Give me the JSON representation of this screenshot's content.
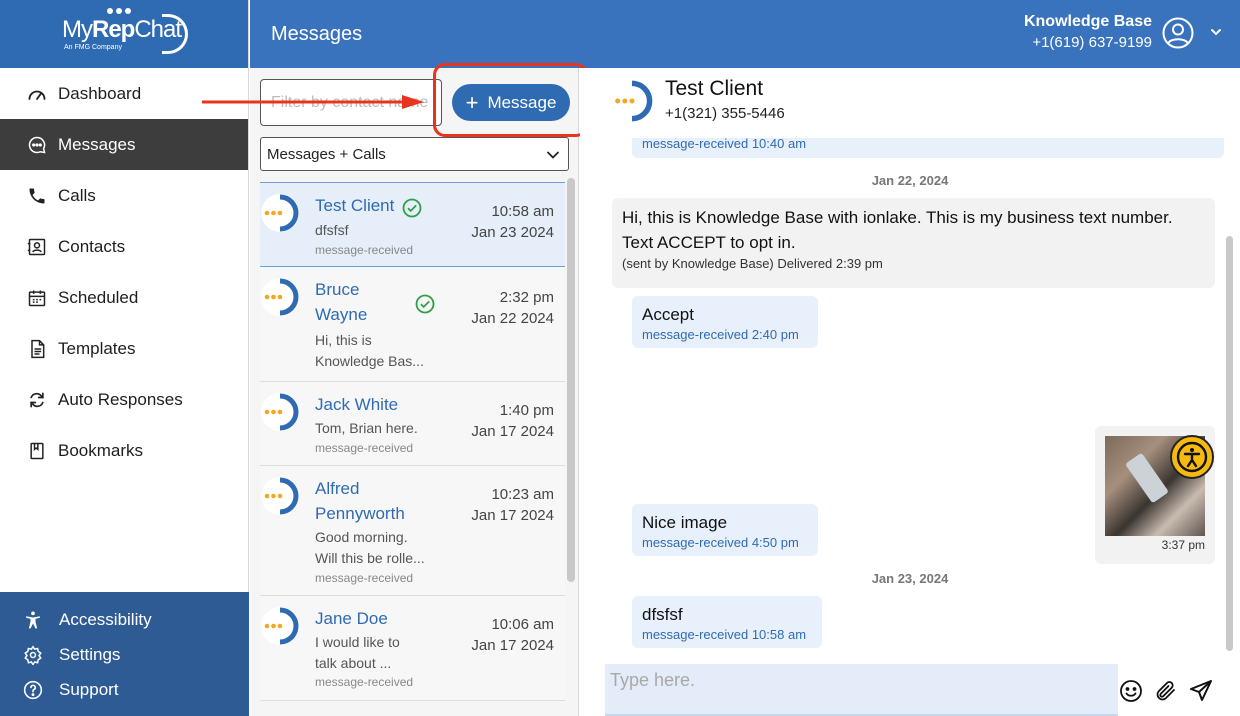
{
  "logo": {
    "text_my": "My",
    "text_rep": "Rep",
    "text_chat": "Chat",
    "tagline": "An FMG Company"
  },
  "sidebar": {
    "items": [
      {
        "label": "Dashboard",
        "icon": "gauge-icon"
      },
      {
        "label": "Messages",
        "icon": "chat-bubble-icon",
        "active": true
      },
      {
        "label": "Calls",
        "icon": "phone-icon"
      },
      {
        "label": "Contacts",
        "icon": "contact-card-icon"
      },
      {
        "label": "Scheduled",
        "icon": "calendar-icon"
      },
      {
        "label": "Templates",
        "icon": "document-icon"
      },
      {
        "label": "Auto Responses",
        "icon": "refresh-icon"
      },
      {
        "label": "Bookmarks",
        "icon": "bookmark-icon"
      }
    ],
    "footer": [
      {
        "label": "Accessibility",
        "icon": "accessibility-icon"
      },
      {
        "label": "Settings",
        "icon": "gear-icon"
      },
      {
        "label": "Support",
        "icon": "help-icon"
      }
    ]
  },
  "header": {
    "title": "Messages",
    "account_name": "Knowledge Base",
    "account_phone": "+1(619) 637-9199"
  },
  "list": {
    "filter_placeholder": "Filter by contact name",
    "new_message_label": "Message",
    "type_select": "Messages + Calls",
    "conversations": [
      {
        "name": "Test Client",
        "preview": "dfsfsf",
        "status": "message-received",
        "time": "10:58 am",
        "date": "Jan 23 2024",
        "checked": true
      },
      {
        "name": "Bruce Wayne",
        "name_line1": "Bruce",
        "name_line2": "Wayne",
        "preview": "Hi, this is Knowledge Bas...",
        "preview_line1": "Hi, this is",
        "preview_line2": "Knowledge Bas...",
        "time": "2:32 pm",
        "date": "Jan 22 2024",
        "checked": true
      },
      {
        "name": "Jack White",
        "preview": "Tom, Brian here.",
        "status": "message-received",
        "time": "1:40 pm",
        "date": "Jan 17 2024"
      },
      {
        "name": "Alfred Pennyworth",
        "name_line1": "Alfred",
        "name_line2": "Pennyworth",
        "preview_line1": "Good morning.",
        "preview_line2": "Will this be rolle...",
        "status": "message-received",
        "time": "10:23 am",
        "date": "Jan 17 2024"
      },
      {
        "name": "Jane Doe",
        "preview_line1": "I would like to",
        "preview_line2": "talk about ...",
        "status": "message-received",
        "time": "10:06 am",
        "date": "Jan 17 2024"
      }
    ]
  },
  "chat": {
    "contact_name": "Test Client",
    "contact_phone": "+1(321) 355-5446",
    "messages": [
      {
        "meta": "message-received 10:40 am"
      },
      {
        "date_separator": "Jan 22, 2024"
      },
      {
        "direction": "out",
        "text_line1": "Hi, this is Knowledge Base with ionlake. This is my business text number.",
        "text_line2": "Text ACCEPT to opt in.",
        "meta": "(sent by Knowledge Base) Delivered 2:39 pm"
      },
      {
        "direction": "in",
        "text": "Accept",
        "meta": "message-received 2:40 pm"
      },
      {
        "direction": "out",
        "image": true,
        "time": "3:37 pm"
      },
      {
        "direction": "in",
        "text": "Nice image",
        "meta": "message-received 4:50 pm"
      },
      {
        "date_separator": "Jan 23, 2024"
      },
      {
        "direction": "in",
        "text": "dfsfsf",
        "meta": "message-received 10:58 am"
      }
    ],
    "composer_placeholder": "Type here."
  },
  "colors": {
    "brand_blue": "#3a73bd",
    "sidebar_active": "#3d3d3d",
    "highlight_red": "#e8341c",
    "bubble_in": "#e8f1fb",
    "avatar_orange": "#f5a623"
  }
}
